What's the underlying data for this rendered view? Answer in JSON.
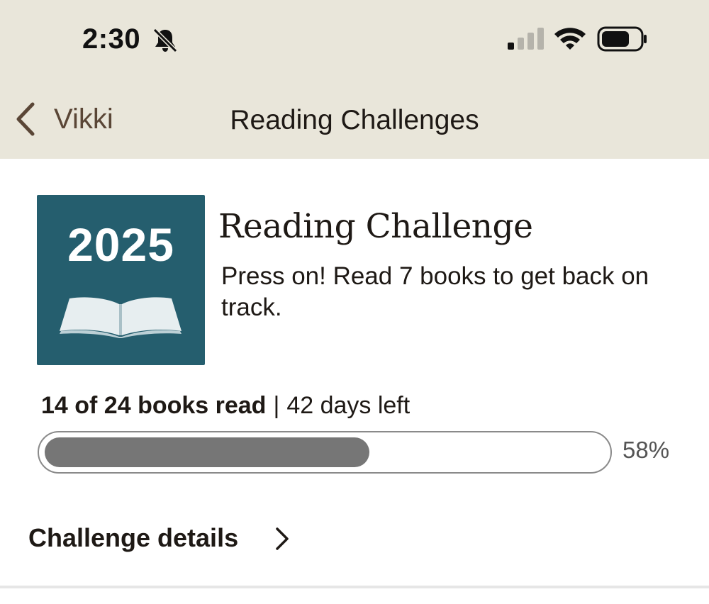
{
  "status_bar": {
    "time": "2:30",
    "icons": [
      "bell-off-icon",
      "cellular-signal-icon",
      "wifi-icon",
      "battery-icon"
    ]
  },
  "nav": {
    "back_label": "Vikki",
    "title": "Reading Challenges"
  },
  "challenge": {
    "badge_year": "2025",
    "badge_icon": "open-book-icon",
    "title": "Reading Challenge",
    "message": "Press on! Read 7 books to get back on track.",
    "books_read_text": "14 of 24 books read",
    "separator": "|",
    "days_left_text": "42 days left",
    "progress_fraction": 0.58,
    "progress_percent_label": "58%",
    "details_label": "Challenge details"
  },
  "colors": {
    "header_background": "#e9e6da",
    "badge_background": "#255e6e",
    "progress_fill": "#767676",
    "back_label": "#5a4636"
  }
}
